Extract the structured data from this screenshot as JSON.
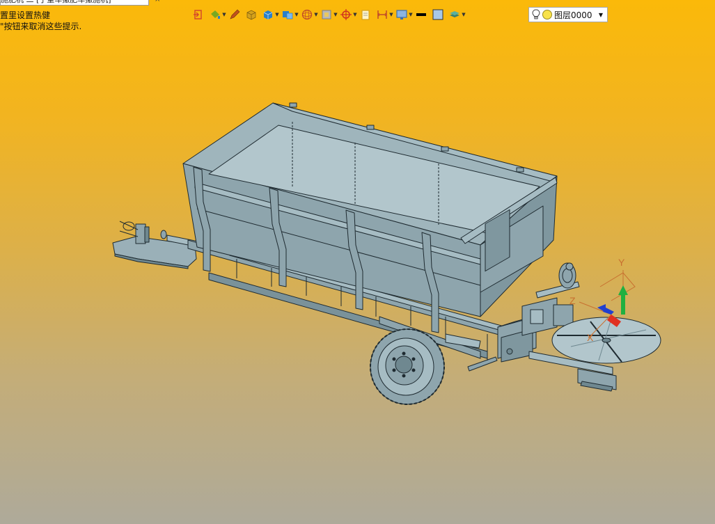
{
  "window": {
    "tab_title": "施肥机·二·[子重车撒肥车撒施机]",
    "tab_close": "×"
  },
  "hints": {
    "line1": "置里设置热健",
    "line2": "\"按钮来取消这些提示."
  },
  "toolbar": {
    "buttons": [
      {
        "icon": "exit-icon",
        "color": "#d44a2a",
        "dropdown": false
      },
      {
        "icon": "paint-bucket-icon",
        "color": "#7aa820",
        "dropdown": true
      },
      {
        "icon": "pencil-icon",
        "color": "#c0501c",
        "dropdown": false
      },
      {
        "icon": "shaded-box-icon",
        "color": "#d4a21c",
        "dropdown": false
      },
      {
        "icon": "solid-box-icon",
        "color": "#2a7fc8",
        "dropdown": true
      },
      {
        "icon": "view-cube-icon",
        "color": "#2a7fc8",
        "dropdown": true
      },
      {
        "icon": "render-sphere-icon",
        "color": "#c04a2a",
        "dropdown": true
      },
      {
        "icon": "display-mode-icon",
        "color": "#808080",
        "dropdown": true
      },
      {
        "icon": "snap-target-icon",
        "color": "#d03020",
        "dropdown": true
      },
      {
        "icon": "sheet-icon",
        "color": "#d4a21c",
        "dropdown": false
      },
      {
        "icon": "dimension-icon",
        "color": "#c04a2a",
        "dropdown": true
      },
      {
        "icon": "monitor-icon",
        "color": "#3a6fb0",
        "dropdown": true
      },
      {
        "icon": "line-color-icon",
        "color": "#000000",
        "dropdown": false
      },
      {
        "icon": "fill-color-icon",
        "color": "#a8c8e8",
        "dropdown": false
      },
      {
        "icon": "layers-icon",
        "color": "#5ab0a0",
        "dropdown": true
      }
    ],
    "layer": {
      "name": "图层0000",
      "arrow": "▼"
    }
  },
  "triad": {
    "x": "X",
    "y": "Y",
    "z": "Z"
  },
  "colors": {
    "model_fill": "#8ea5ad",
    "model_fill_light": "#a6bcc3",
    "model_fill_dark": "#6f8890",
    "model_edge": "#1e2a30",
    "axis_x": "#e03020",
    "axis_y": "#20b040",
    "axis_z": "#2040d0",
    "axis_ref": "#c87030"
  }
}
